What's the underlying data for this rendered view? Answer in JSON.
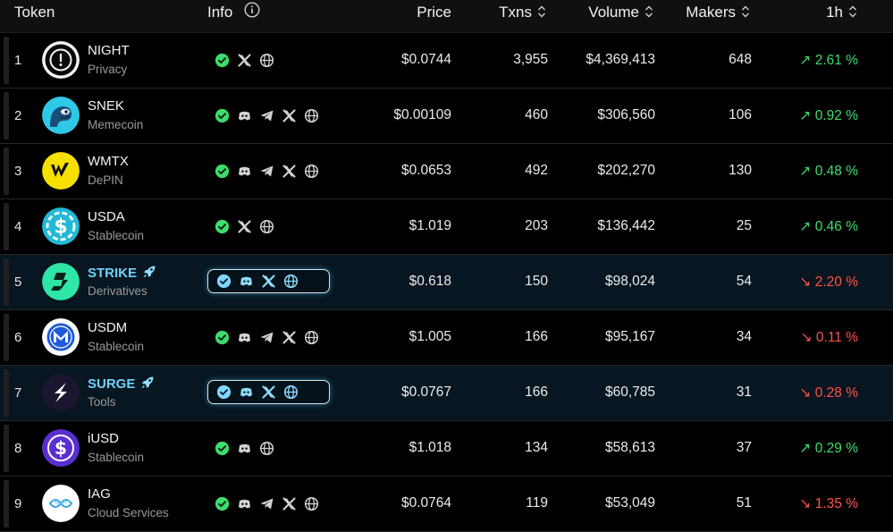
{
  "header": {
    "token": "Token",
    "info": "Info",
    "price": "Price",
    "txns": "Txns",
    "volume": "Volume",
    "makers": "Makers",
    "change": "1h"
  },
  "colors": {
    "up": "#3ddc6d",
    "down": "#ff5348",
    "highlight_name": "#6fd2ff"
  },
  "rows": [
    {
      "rank": "1",
      "name": "NIGHT",
      "category": "Privacy",
      "price": "$0.0744",
      "txns": "3,955",
      "volume": "$4,369,413",
      "makers": "648",
      "change": "2.61 %",
      "dir": "up",
      "highlight": false,
      "logo": "night-logo",
      "links": [
        "verified",
        "x",
        "web"
      ]
    },
    {
      "rank": "2",
      "name": "SNEK",
      "category": "Memecoin",
      "price": "$0.00109",
      "txns": "460",
      "volume": "$306,560",
      "makers": "106",
      "change": "0.92 %",
      "dir": "up",
      "highlight": false,
      "logo": "snek-logo",
      "links": [
        "verified",
        "discord",
        "telegram",
        "x",
        "web"
      ]
    },
    {
      "rank": "3",
      "name": "WMTX",
      "category": "DePIN",
      "price": "$0.0653",
      "txns": "492",
      "volume": "$202,270",
      "makers": "130",
      "change": "0.48 %",
      "dir": "up",
      "highlight": false,
      "logo": "wmtx-logo",
      "links": [
        "verified",
        "discord",
        "telegram",
        "x",
        "web"
      ]
    },
    {
      "rank": "4",
      "name": "USDA",
      "category": "Stablecoin",
      "price": "$1.019",
      "txns": "203",
      "volume": "$136,442",
      "makers": "25",
      "change": "0.46 %",
      "dir": "up",
      "highlight": false,
      "logo": "usda-logo",
      "links": [
        "verified",
        "x",
        "web"
      ]
    },
    {
      "rank": "5",
      "name": "STRIKE",
      "category": "Derivatives",
      "price": "$0.618",
      "txns": "150",
      "volume": "$98,024",
      "makers": "54",
      "change": "2.20 %",
      "dir": "down",
      "highlight": true,
      "logo": "strike-logo",
      "links": [
        "verified",
        "discord",
        "x",
        "web"
      ]
    },
    {
      "rank": "6",
      "name": "USDM",
      "category": "Stablecoin",
      "price": "$1.005",
      "txns": "166",
      "volume": "$95,167",
      "makers": "34",
      "change": "0.11 %",
      "dir": "down",
      "highlight": false,
      "logo": "usdm-logo",
      "links": [
        "verified",
        "discord",
        "telegram",
        "x",
        "web"
      ]
    },
    {
      "rank": "7",
      "name": "SURGE",
      "category": "Tools",
      "price": "$0.0767",
      "txns": "166",
      "volume": "$60,785",
      "makers": "31",
      "change": "0.28 %",
      "dir": "down",
      "highlight": true,
      "logo": "surge-logo",
      "links": [
        "verified",
        "discord",
        "x",
        "web"
      ]
    },
    {
      "rank": "8",
      "name": "iUSD",
      "category": "Stablecoin",
      "price": "$1.018",
      "txns": "134",
      "volume": "$58,613",
      "makers": "37",
      "change": "0.29 %",
      "dir": "up",
      "highlight": false,
      "logo": "iusd-logo",
      "links": [
        "verified",
        "discord",
        "web"
      ]
    },
    {
      "rank": "9",
      "name": "IAG",
      "category": "Cloud Services",
      "price": "$0.0764",
      "txns": "119",
      "volume": "$53,049",
      "makers": "51",
      "change": "1.35 %",
      "dir": "down",
      "highlight": false,
      "logo": "iag-logo",
      "links": [
        "verified",
        "discord",
        "telegram",
        "x",
        "web"
      ]
    }
  ]
}
